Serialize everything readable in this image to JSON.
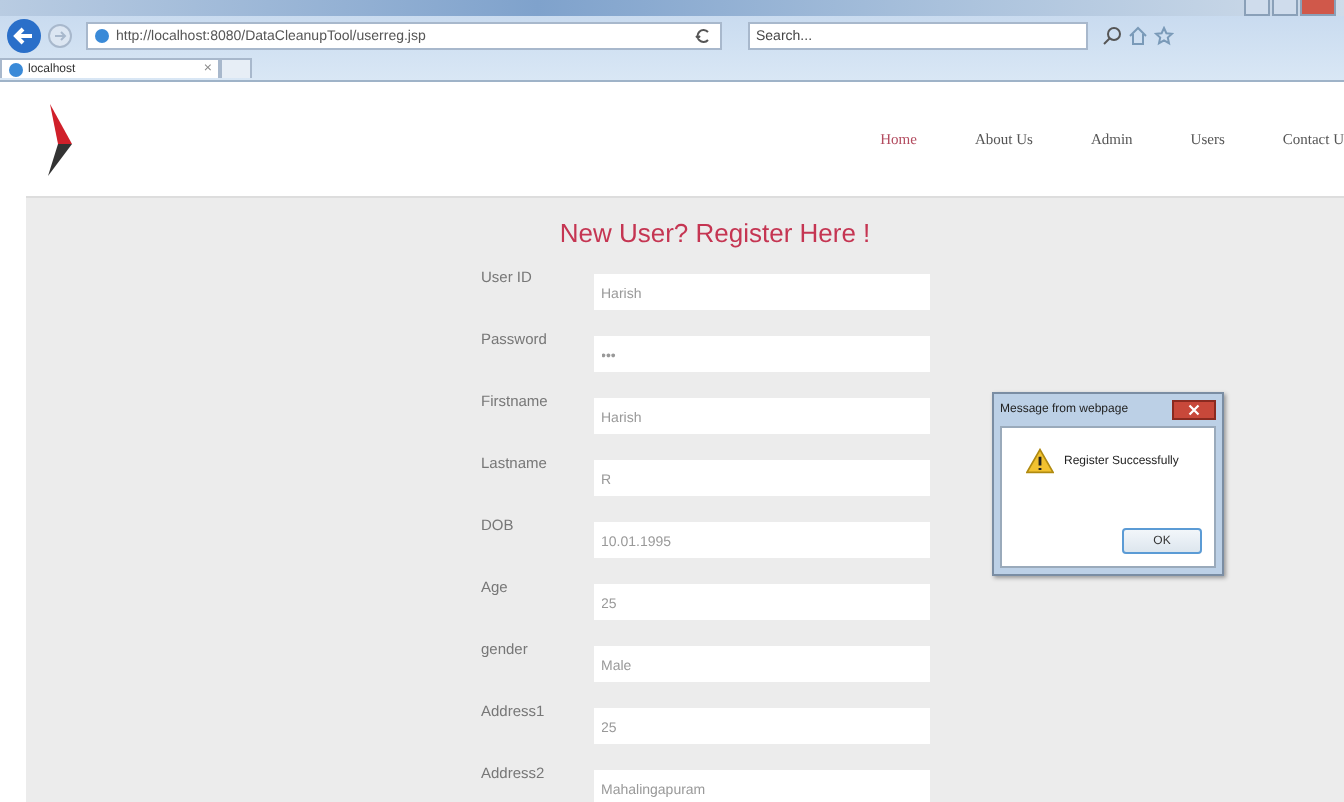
{
  "browser": {
    "address": "http://localhost:8080/DataCleanupTool/userreg.jsp",
    "search": {
      "placeholder": "Search..."
    },
    "tab": {
      "title": "localhost",
      "close": "×"
    }
  },
  "nav": [
    {
      "label": "Home",
      "selected": true
    },
    {
      "label": "About Us",
      "selected": false
    },
    {
      "label": "Admin",
      "selected": false
    },
    {
      "label": "Users",
      "selected": false
    },
    {
      "label": "Contact U",
      "selected": false
    }
  ],
  "form": {
    "title": "New User? Register Here !",
    "fields": [
      {
        "label": "User ID",
        "value": "Harish"
      },
      {
        "label": "Password",
        "value": "•••"
      },
      {
        "label": "Firstname",
        "value": "Harish"
      },
      {
        "label": "Lastname",
        "value": "R"
      },
      {
        "label": "DOB",
        "value": "10.01.1995"
      },
      {
        "label": "Age",
        "value": "25"
      },
      {
        "label": "gender",
        "value": "Male"
      },
      {
        "label": "Address1",
        "value": "25"
      },
      {
        "label": "Address2",
        "value": "Mahalingapuram"
      }
    ]
  },
  "dialog": {
    "title": "Message from webpage",
    "message": "Register Successfully",
    "button": "OK"
  }
}
